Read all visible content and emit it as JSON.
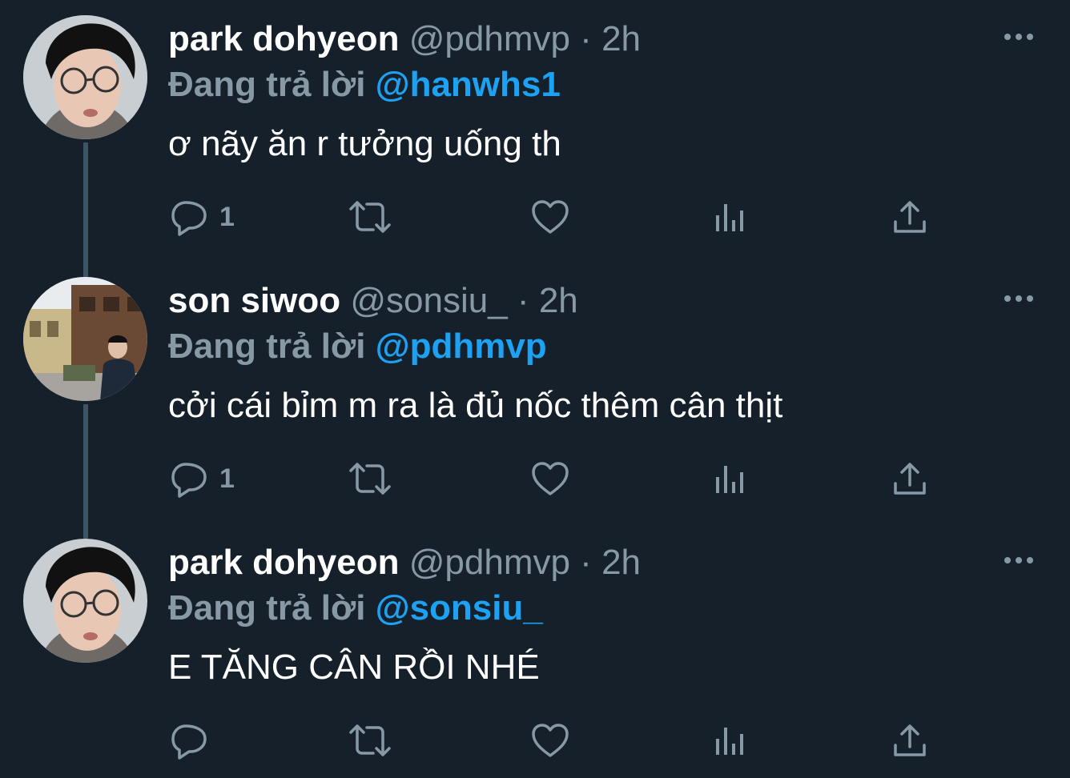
{
  "theme": {
    "background": "#15202b",
    "text_primary": "#ffffff",
    "text_secondary": "#8899a6",
    "link": "#1da1f2",
    "thread_line": "#3d5466"
  },
  "tweets": [
    {
      "name": "park dohyeon",
      "handle": "@pdhmvp",
      "dot": "·",
      "time": "2h",
      "reply_prefix": "Đang trả lời",
      "reply_to": "@hanwhs1",
      "text": "ơ nãy ăn r tưởng uống th",
      "reply_count": "1",
      "avatar_icon": "avatar-glasses-person"
    },
    {
      "name": "son siwoo",
      "handle": "@sonsiu_",
      "dot": "·",
      "time": "2h",
      "reply_prefix": "Đang trả lời",
      "reply_to": "@pdhmvp",
      "text": "cởi cái bỉm m ra là đủ nốc thêm cân thịt",
      "reply_count": "1",
      "avatar_icon": "avatar-street-photo"
    },
    {
      "name": "park dohyeon",
      "handle": "@pdhmvp",
      "dot": "·",
      "time": "2h",
      "reply_prefix": "Đang trả lời",
      "reply_to": "@sonsiu_",
      "text": "E TĂNG CÂN RỒI NHÉ",
      "reply_count": "",
      "avatar_icon": "avatar-glasses-person"
    }
  ],
  "icons": {
    "reply": "reply-icon",
    "retweet": "retweet-icon",
    "like": "like-icon",
    "analytics": "analytics-icon",
    "share": "share-icon",
    "more": "more-icon"
  }
}
